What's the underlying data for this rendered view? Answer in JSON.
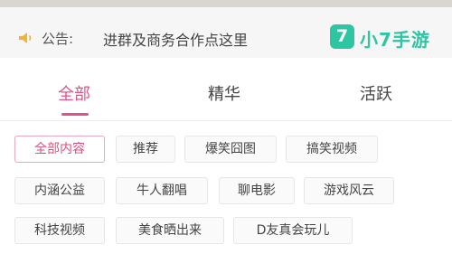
{
  "notice": {
    "label": "公告:",
    "text": "进群及商务合作点这里"
  },
  "logo": {
    "glyph": "7",
    "text": "小7手游",
    "accent": "#2ec5a3"
  },
  "tabs": [
    {
      "label": "全部",
      "active": true
    },
    {
      "label": "精华",
      "active": false
    },
    {
      "label": "活跃",
      "active": false
    }
  ],
  "categories": [
    {
      "label": "全部内容",
      "selected": true
    },
    {
      "label": "推荐",
      "selected": false
    },
    {
      "label": "爆笑囧图",
      "selected": false
    },
    {
      "label": "搞笑视频",
      "selected": false
    },
    {
      "label": "内涵公益",
      "selected": false
    },
    {
      "label": "牛人翻唱",
      "selected": false
    },
    {
      "label": "聊电影",
      "selected": false
    },
    {
      "label": "游戏风云",
      "selected": false
    },
    {
      "label": "科技视频",
      "selected": false
    },
    {
      "label": "美食晒出来",
      "selected": false
    },
    {
      "label": "D友真会玩儿",
      "selected": false
    }
  ],
  "colors": {
    "accent_pink": "#e0538a",
    "brand_green": "#2ec5a3"
  }
}
